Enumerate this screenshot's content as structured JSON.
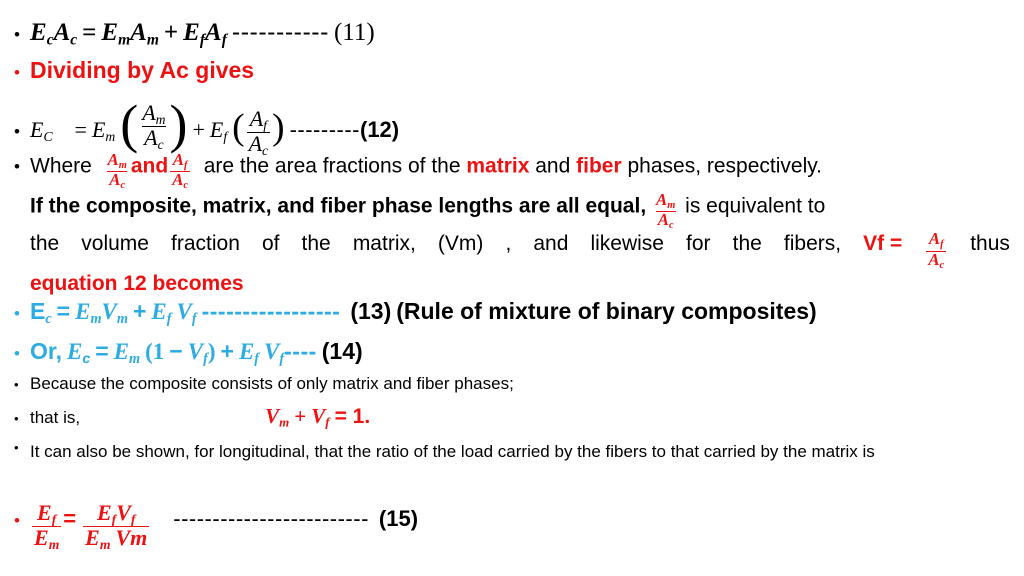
{
  "slide": {
    "background": "#ffffff",
    "colors": {
      "red": "#EE1111",
      "cyan": "#2CACE3",
      "black": "#000000"
    }
  },
  "eq11": {
    "bullet": "•",
    "lhs_E": "E",
    "lhs_sub": "c",
    "lhs_A": "A",
    "lhs_A_sub": "c",
    "equals": "=",
    "t1_E": "E",
    "t1_sub": "m",
    "t1_A": "A",
    "t1_A_sub": "m",
    "plus": "+",
    "t2_E": "E",
    "t2_sub": "f",
    "t2_A": "A",
    "t2_A_sub": "f",
    "dashes": "-----------",
    "number": "(11)"
  },
  "dividing": {
    "bullet": "•",
    "text": "Dividing by Ac gives"
  },
  "eq12": {
    "bullet": "•",
    "lhs_E": "E",
    "lhs_sub": "C",
    "equals": "=",
    "t1_E": "E",
    "t1_sub": "m",
    "frac1_num": "A",
    "frac1_num_sub": "m",
    "frac1_den": "A",
    "frac1_den_sub": "c",
    "paren_open": "(",
    "paren_close": ")",
    "plus": "+",
    "t2_E": "E",
    "t2_sub": "f",
    "frac2_num": "A",
    "frac2_num_sub": "f",
    "frac2_den": "A",
    "frac2_den_sub": "c",
    "dashes": "---------",
    "number": "(12)"
  },
  "where_para": {
    "bullet": "•",
    "line1_a": "Where",
    "frac_m_num": "A",
    "frac_m_num_sub": "m",
    "frac_m_den": "A",
    "frac_m_den_sub": "c",
    "and": "and",
    "frac_f_num": "A",
    "frac_f_num_sub": "f",
    "frac_f_den": "A",
    "frac_f_den_sub": "c",
    "line1_b": "are the area fractions of the",
    "matrix": "matrix",
    "line1_c": "and",
    "fiber": "fiber",
    "line1_d": "phases, respectively.",
    "line2_a": "If the composite, matrix, and fiber phase lengths are all equal,",
    "line2_b": "is equivalent to",
    "line3_words": [
      "the",
      "volume",
      "fraction",
      "of",
      "the",
      "matrix,",
      "(Vm)",
      ",",
      "and",
      "likewise",
      "for",
      "the",
      "fibers,"
    ],
    "vf_label": "Vf =",
    "line3_end": "thus",
    "line4": "equation 12 becomes"
  },
  "eq13": {
    "bullet": "•",
    "lhs_E": "E",
    "lhs_sub": "c",
    "equals": "=",
    "t1_E": "E",
    "t1_sub": "m",
    "t1_V": "V",
    "t1_V_sub": "m",
    "plus": "+",
    "t2_E": "E",
    "t2_sub": "f",
    "t2_V": "V",
    "t2_V_sub": "f",
    "dashes": "-----------------",
    "number": "(13)",
    "caption": "(Rule of mixture of binary composites)"
  },
  "eq14": {
    "bullet": "•",
    "or": "Or,",
    "lhs_E": "E",
    "lhs_sub": "c",
    "equals": "=",
    "t1_E": "E",
    "t1_sub": "m",
    "paren_open": "(",
    "one": "1",
    "minus": "−",
    "V": "V",
    "V_sub": "f",
    "paren_close": ")",
    "plus": "+",
    "t2_E": "E",
    "t2_sub": "f",
    "t2_V": "V",
    "t2_V_sub": "f",
    "dashes": "----",
    "number": "(14)"
  },
  "because": {
    "bullet": "•",
    "text": "Because the composite consists of only matrix and fiber phases;"
  },
  "thatis": {
    "bullet": "•",
    "text": "that is,",
    "V1": "V",
    "V1_sub": "m",
    "plus": "+",
    "V2": "V",
    "V2_sub": "f",
    "equals": "= 1."
  },
  "itcan": {
    "bullet": "•",
    "text": "It can also be shown, for longitudinal, that the ratio of the load carried by the fibers to that carried by the matrix is"
  },
  "eq15": {
    "bullet": "•",
    "lhs_num": "E",
    "lhs_num_sub": "f",
    "lhs_den": "E",
    "lhs_den_sub": "m",
    "equals": "=",
    "rhs_num_E": "E",
    "rhs_num_E_sub": "f",
    "rhs_num_V": "V",
    "rhs_num_V_sub": "f",
    "rhs_den_E": "E",
    "rhs_den_E_sub": "m",
    "rhs_den_V": "Vm",
    "dashes": "-------------------------",
    "number": "(15)"
  }
}
